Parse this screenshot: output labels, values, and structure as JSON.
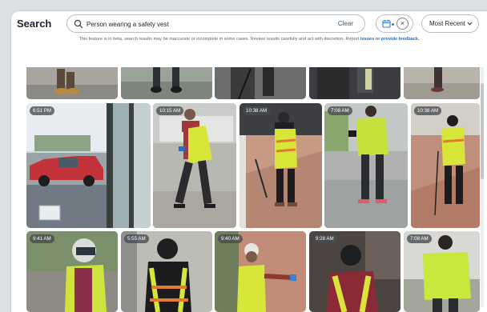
{
  "header": {
    "title": "Search",
    "search_value": "Person wearing a safety vest",
    "clear_label": "Clear",
    "close_glyph": "×",
    "sort_label": "Most Recent"
  },
  "notice": {
    "text": "This feature is in beta, search results may be inaccurate or incomplete in some cases. Review results carefully and act with discretion. Report ",
    "link": "issues or provide feedback."
  },
  "results": {
    "row2": [
      "6:51 PM",
      "10:15 AM",
      "10:38 AM",
      "7:08 AM",
      "10:38 AM"
    ],
    "row3": [
      "9:41 AM",
      "5:55 AM",
      "9:40 AM",
      "9:28 AM",
      "7:08 AM"
    ]
  },
  "icons": {
    "search": "search-icon",
    "calendar": "calendar-icon",
    "clear_date": "close-icon",
    "sort": "chevron-down-icon"
  },
  "colors": {
    "accent": "#2f7dd1",
    "safety_vest": "#d8e63a"
  }
}
